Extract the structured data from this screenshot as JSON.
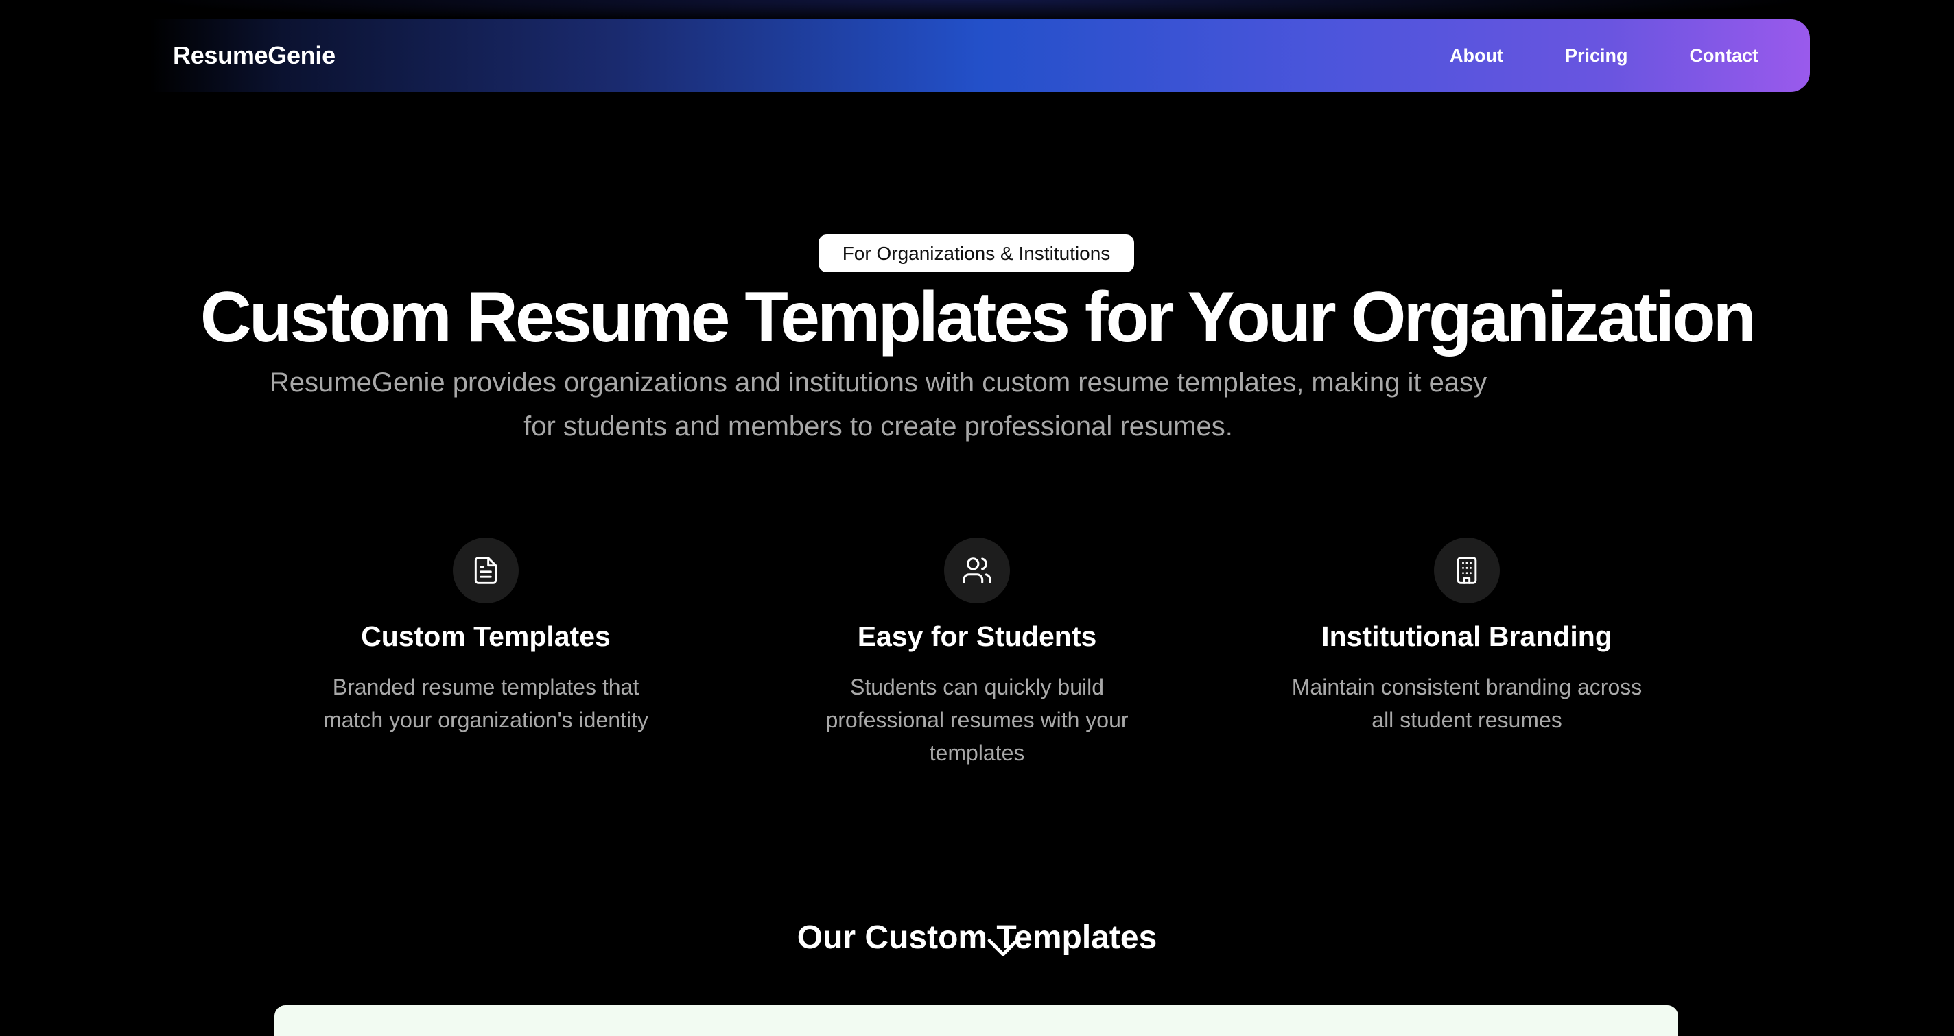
{
  "nav": {
    "brand": "ResumeGenie",
    "links": [
      {
        "label": "About"
      },
      {
        "label": "Pricing"
      },
      {
        "label": "Contact"
      }
    ]
  },
  "hero": {
    "badge": "For Organizations & Institutions",
    "title": "Custom Resume Templates for Your Organization",
    "subtitle": "ResumeGenie provides organizations and institutions with custom resume templates, making it easy for students and members to create professional resumes."
  },
  "features": [
    {
      "icon": "document-icon",
      "title": "Custom Templates",
      "description": "Branded resume templates that match your organization's identity"
    },
    {
      "icon": "users-icon",
      "title": "Easy for Students",
      "description": "Students can quickly build professional resumes with your templates"
    },
    {
      "icon": "building-icon",
      "title": "Institutional Branding",
      "description": "Maintain consistent branding across all student resumes"
    }
  ],
  "templates_section": {
    "title": "Our Custom Templates",
    "scroll_icon": "chevron-down-icon"
  },
  "colors": {
    "background": "#000000",
    "nav_gradient_mid": "#2350c9",
    "nav_gradient_end": "#9a5aec",
    "muted_text": "#a8a8a8",
    "card_background": "#f2fbf2"
  }
}
